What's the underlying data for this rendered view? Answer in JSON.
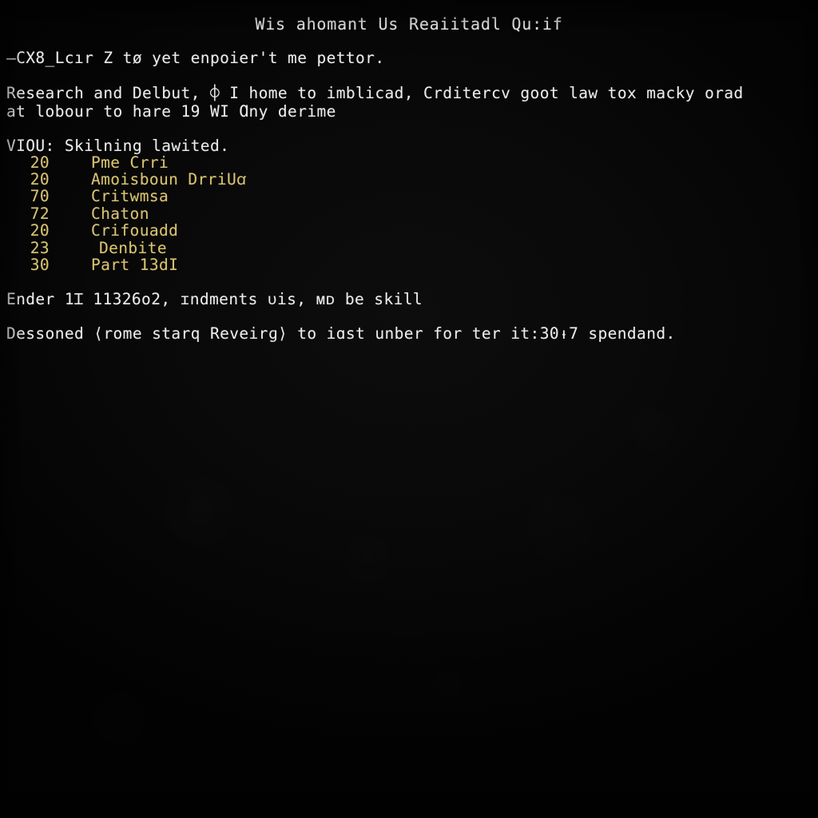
{
  "terminal": {
    "background_color": "#080808",
    "text_color": "#ececec",
    "accent_color": "#d8c371",
    "title": "Wis ahomant Us Reaiitadl Qu:if",
    "command_line": "—CX8_Lcır Z tø yet enpoier't me pettor.",
    "paragraph": {
      "line1": "Research and Delbut, ⌽ I home to imblicad, Crditercv goot law tox macky orad",
      "line2": "at lobour to hare 19 WI Ɑny derime"
    },
    "list": {
      "header": "VIOU: Skilning lawited.",
      "items": [
        {
          "count": "20",
          "label": "Pme Crri",
          "indent": 0
        },
        {
          "count": "20",
          "label": "Amoisboun DrriUꭤ",
          "indent": 0
        },
        {
          "count": "70",
          "label": "Critwmsa",
          "indent": 0
        },
        {
          "count": "72",
          "label": "Chaton",
          "indent": 0
        },
        {
          "count": "20",
          "label": "Crifouadd",
          "indent": 0
        },
        {
          "count": "23",
          "label": "Denbite",
          "indent": 10
        },
        {
          "count": "30",
          "label": "Part 13dI",
          "indent": 0
        }
      ]
    },
    "footer": {
      "line1": "Ender 1Ɪ 11326o2, ɪndments ᴜis, ᴍᴅ be skill",
      "line2": "Dessoned ⟨rome starq Reveirɡ⟩ to iɑst unber for ter it:30ᵼ7 spendand."
    }
  }
}
